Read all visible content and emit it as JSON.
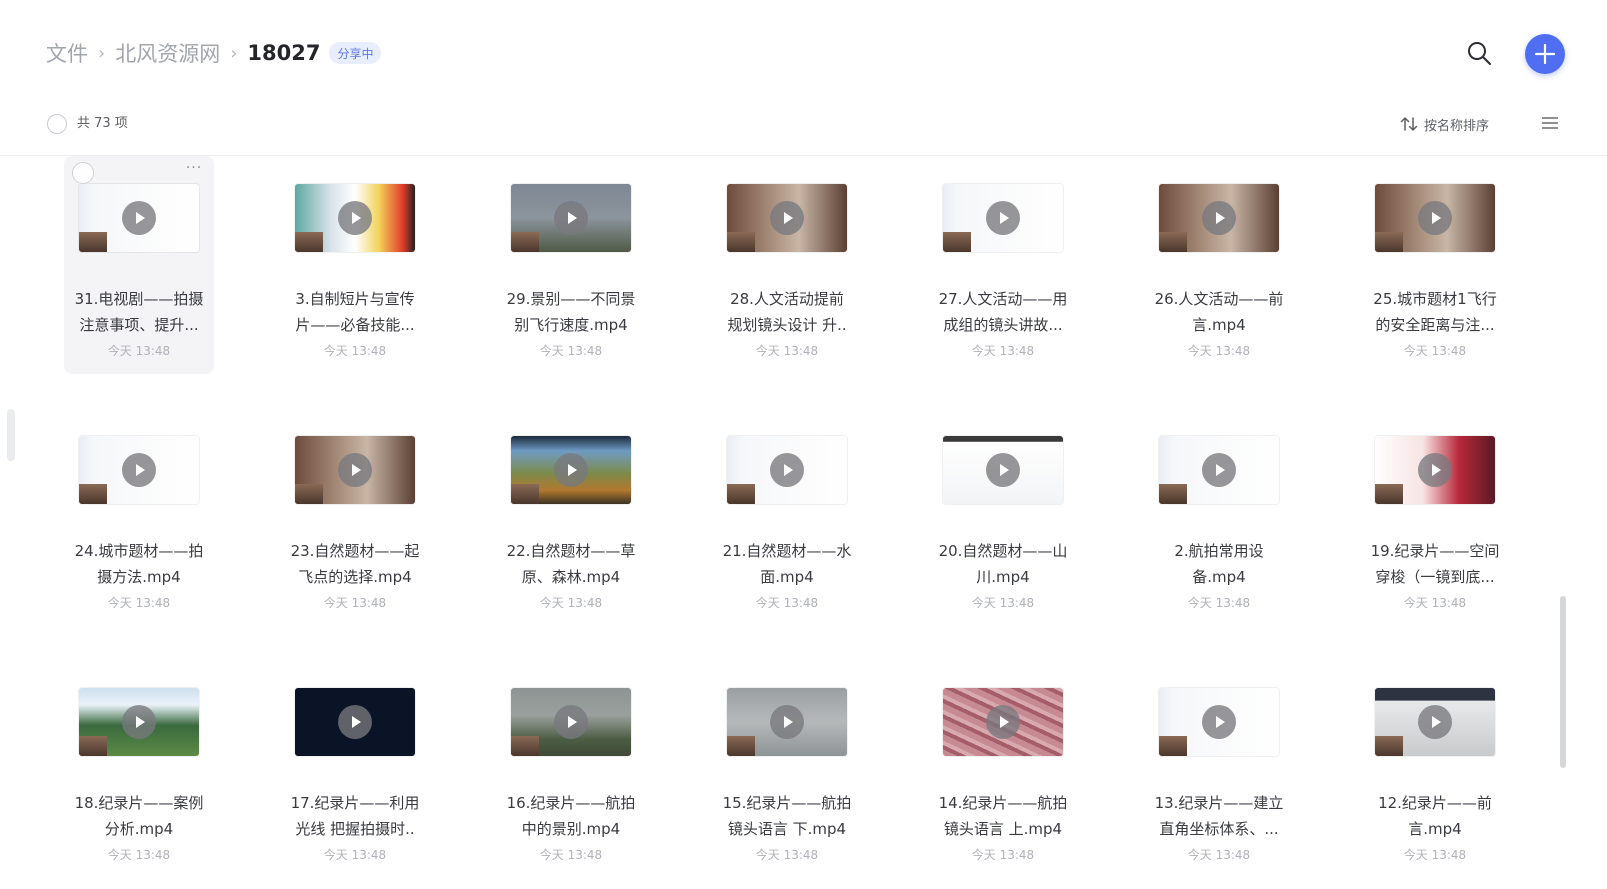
{
  "breadcrumb": {
    "items": [
      "文件",
      "北风资源网"
    ],
    "current": "18027",
    "badge": "分享中"
  },
  "toolbar": {
    "count_label": "共 73 项",
    "sort_label": "按名称排序"
  },
  "icons": {
    "search": "search-icon",
    "add": "plus-icon",
    "sort": "sort-arrows-icon",
    "list_view": "list-view-icon",
    "play": "play-icon"
  },
  "colors": {
    "accent": "#4f6ef2",
    "badge_bg": "#e9eefe",
    "badge_text": "#5c78e8"
  },
  "files": [
    {
      "line1": "31.电视剧——拍摄",
      "line2": "注意事项、提升...",
      "time": "今天 13:48",
      "thumb": "slides",
      "selected": true
    },
    {
      "line1": "3.自制短片与宣传",
      "line2": "片——必备技能...",
      "time": "今天 13:48",
      "thumb": "colorful"
    },
    {
      "line1": "29.景别——不同景",
      "line2": "别飞行速度.mp4",
      "time": "今天 13:48",
      "thumb": "statue"
    },
    {
      "line1": "28.人文活动提前",
      "line2": "规划镜头设计 升..",
      "time": "今天 13:48",
      "thumb": "room"
    },
    {
      "line1": "27.人文活动——用",
      "line2": "成组的镜头讲故...",
      "time": "今天 13:48",
      "thumb": "slides"
    },
    {
      "line1": "26.人文活动——前",
      "line2": "言.mp4",
      "time": "今天 13:48",
      "thumb": "room"
    },
    {
      "line1": "25.城市题材1飞行",
      "line2": "的安全距离与注...",
      "time": "今天 13:48",
      "thumb": "room"
    },
    {
      "line1": "24.城市题材——拍",
      "line2": "摄方法.mp4",
      "time": "今天 13:48",
      "thumb": "slides"
    },
    {
      "line1": "23.自然题材——起",
      "line2": "飞点的选择.mp4",
      "time": "今天 13:48",
      "thumb": "room"
    },
    {
      "line1": "22.自然题材——草",
      "line2": "原、森林.mp4",
      "time": "今天 13:48",
      "thumb": "forest"
    },
    {
      "line1": "21.自然题材——水",
      "line2": "面.mp4",
      "time": "今天 13:48",
      "thumb": "slides"
    },
    {
      "line1": "20.自然题材——山",
      "line2": "川.mp4",
      "time": "今天 13:48",
      "thumb": "white"
    },
    {
      "line1": "2.航拍常用设",
      "line2": "备.mp4",
      "time": "今天 13:48",
      "thumb": "slides"
    },
    {
      "line1": "19.纪录片——空间",
      "line2": "穿梭（一镜到底...",
      "time": "今天 13:48",
      "thumb": "red"
    },
    {
      "line1": "18.纪录片——案例",
      "line2": "分析.mp4",
      "time": "今天 13:48",
      "thumb": "field"
    },
    {
      "line1": "17.纪录片——利用",
      "line2": "光线 把握拍摄时..",
      "time": "今天 13:48",
      "thumb": "dark"
    },
    {
      "line1": "16.纪录片——航拍",
      "line2": "中的景别.mp4",
      "time": "今天 13:48",
      "thumb": "mist"
    },
    {
      "line1": "15.纪录片——航拍",
      "line2": "镜头语言 下.mp4",
      "time": "今天 13:48",
      "thumb": "fog"
    },
    {
      "line1": "14.纪录片——航拍",
      "line2": "镜头语言 上.mp4",
      "time": "今天 13:48",
      "thumb": "pink"
    },
    {
      "line1": "13.纪录片——建立",
      "line2": "直角坐标体系、...",
      "time": "今天 13:48",
      "thumb": "slides"
    },
    {
      "line1": "12.纪录片——前",
      "line2": "言.mp4",
      "time": "今天 13:48",
      "thumb": "grey"
    }
  ]
}
